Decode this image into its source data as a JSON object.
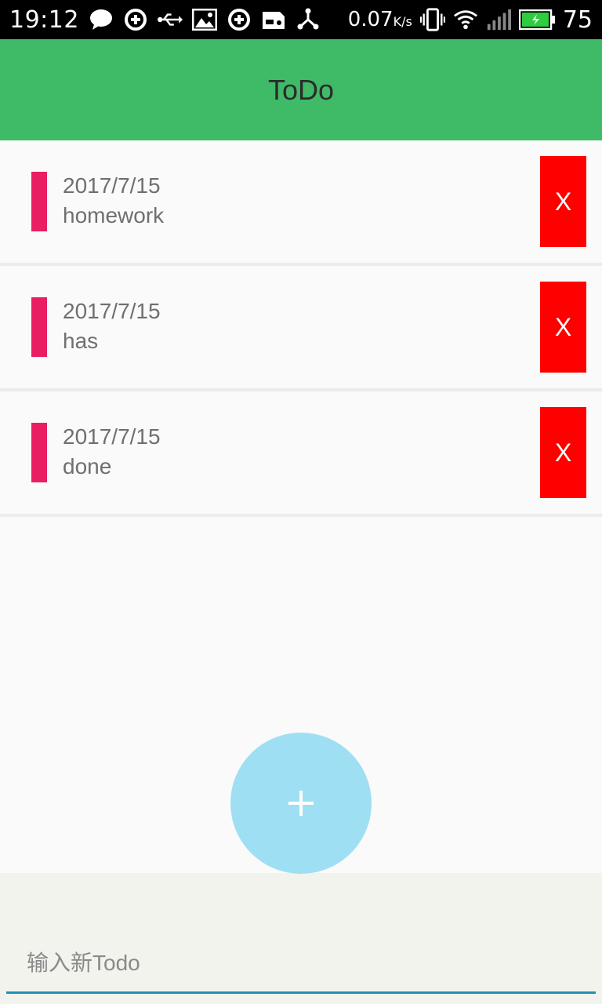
{
  "status_bar": {
    "time": "19:12",
    "net_speed": "0.07",
    "net_speed_unit": "K/s",
    "battery": "75",
    "icons": [
      "chat-icon",
      "sync-icon",
      "usb-icon",
      "image-icon",
      "sync-icon",
      "sd-card-icon",
      "share-icon",
      "vibrate-icon",
      "wifi-icon",
      "signal-icon",
      "battery-icon"
    ]
  },
  "app_bar": {
    "title": "ToDo"
  },
  "todos": [
    {
      "date": "2017/7/15",
      "text": "homework",
      "delete_label": "X"
    },
    {
      "date": "2017/7/15",
      "text": "has",
      "delete_label": "X"
    },
    {
      "date": "2017/7/15",
      "text": "done",
      "delete_label": "X"
    }
  ],
  "add_button": {
    "label": "+"
  },
  "input": {
    "placeholder": "输入新Todo",
    "value": ""
  },
  "colors": {
    "app_bar": "#3fba66",
    "marker": "#e91e63",
    "delete": "#ff0000",
    "fab": "#9fdff3",
    "input_underline": "#2191b6"
  }
}
